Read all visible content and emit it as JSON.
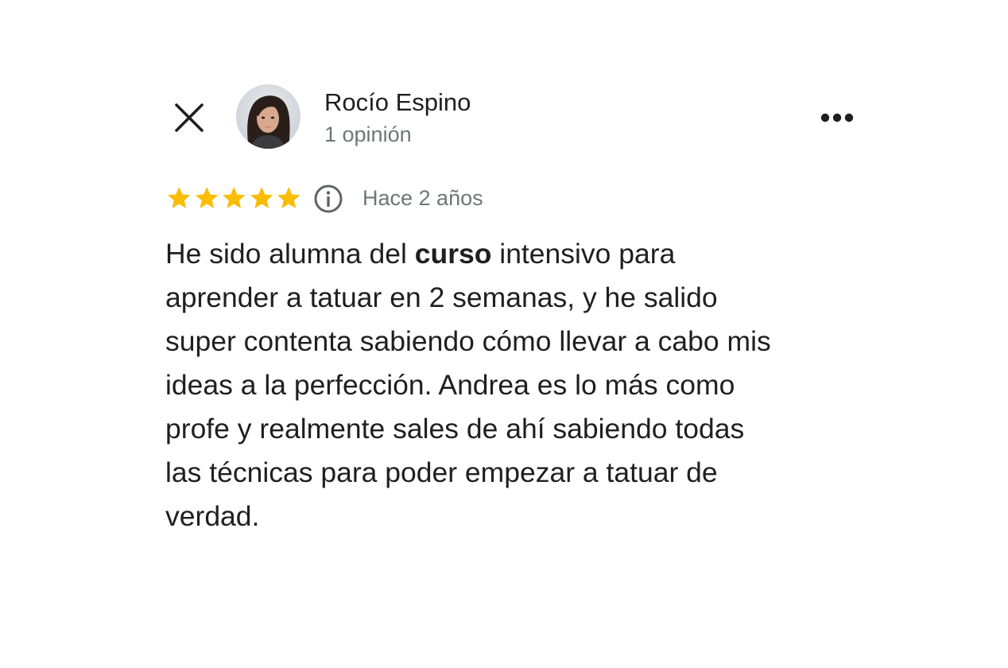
{
  "reviewer": {
    "name": "Rocío Espino",
    "review_count": "1 opinión"
  },
  "icons": {
    "close": "close-icon",
    "more": "more-horiz-icon",
    "star": "star-icon",
    "info": "info-icon"
  },
  "rating": {
    "stars": 5,
    "max": 5,
    "star_color": "#fbbc04"
  },
  "review": {
    "time": "Hace 2 años",
    "lines": [
      {
        "pre": "He sido alumna del ",
        "bold": "curso",
        "post": " intensivo para"
      },
      {
        "text": "aprender a tatuar en 2 semanas, y he salido"
      },
      {
        "text": "super contenta sabiendo cómo llevar a cabo mis"
      },
      {
        "text": "ideas a la perfección. Andrea es lo más como"
      },
      {
        "text": "profe y realmente sales de ahí sabiendo todas"
      },
      {
        "text": "las técnicas para poder empezar a tatuar de"
      },
      {
        "text": "verdad."
      }
    ]
  },
  "colors": {
    "text_primary": "#1f1f1f",
    "text_secondary": "#70757a",
    "star": "#fbbc04",
    "background": "#ffffff"
  }
}
